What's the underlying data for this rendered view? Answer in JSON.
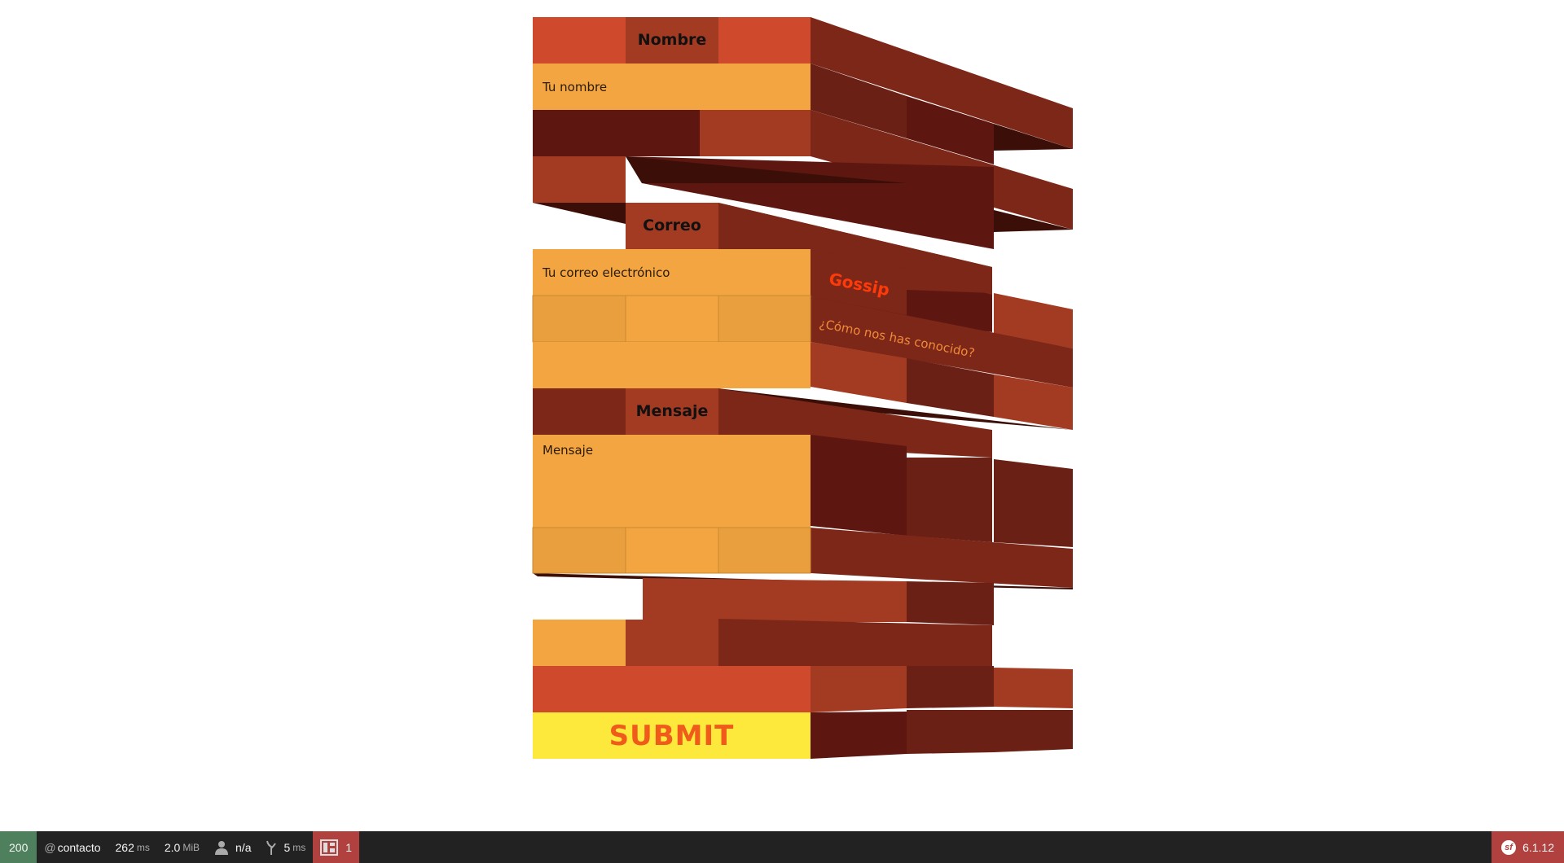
{
  "form": {
    "name_label": "Nombre",
    "name_placeholder": "Tu nombre",
    "email_label": "Correo",
    "email_placeholder": "Tu correo electrónico",
    "message_label": "Mensaje",
    "message_placeholder": "Mensaje",
    "submit_label": "SUBMIT"
  },
  "side": {
    "gossip_label": "Gossip",
    "how_placeholder": "¿Cómo nos has conocido?"
  },
  "toolbar": {
    "status_code": "200",
    "route_prefix": "@",
    "route": "contacto",
    "time_value": "262",
    "time_unit": "ms",
    "memory_value": "2.0",
    "memory_unit": "MiB",
    "user": "n/a",
    "twig_value": "5",
    "twig_unit": "ms",
    "errors": "1",
    "version": "6.1.12"
  },
  "colors": {
    "orange": "#f2a541",
    "orange_dark": "#e99f3e",
    "red": "#cf4a2c",
    "rust": "#a33a22",
    "brown": "#7d2719",
    "brown_dark": "#6a2014",
    "maroon": "#5e1710",
    "yellow": "#fde93b",
    "submit_text": "#f05a1a",
    "toolbar_bg": "#222222",
    "status_ok": "#4f805d",
    "error_red": "#b0413e"
  }
}
